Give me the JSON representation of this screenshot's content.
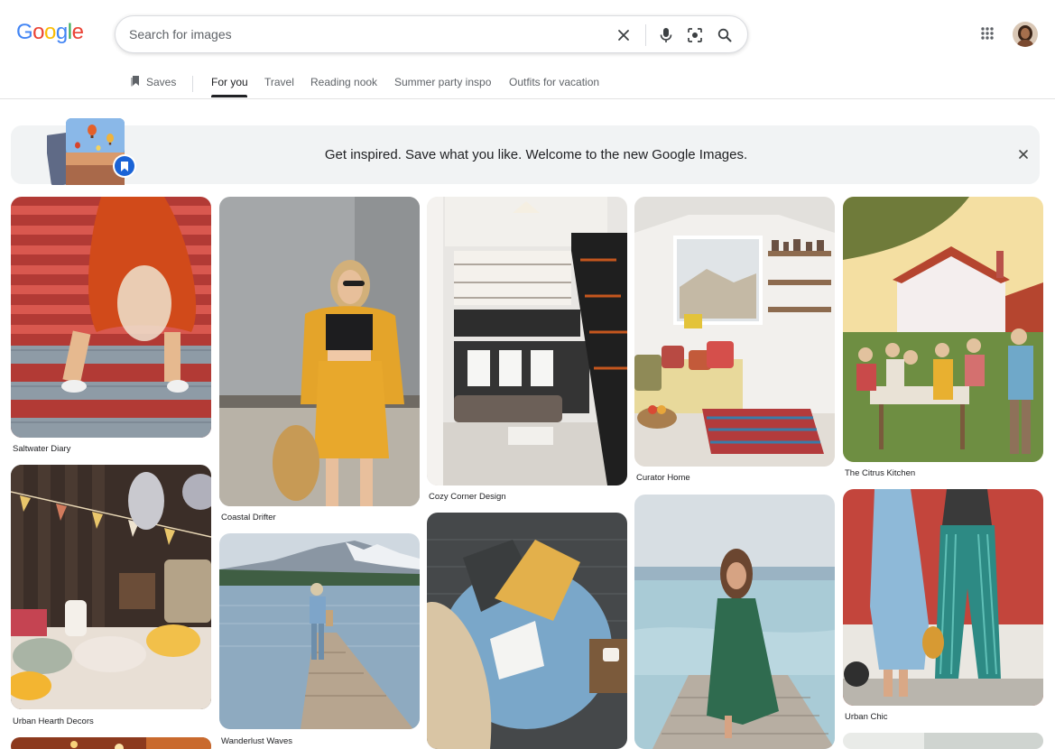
{
  "logo": {
    "letters": [
      "G",
      "o",
      "o",
      "g",
      "l",
      "e"
    ],
    "colors": [
      "#4285F4",
      "#EA4335",
      "#FBBC05",
      "#4285F4",
      "#34A853",
      "#EA4335"
    ]
  },
  "search": {
    "placeholder": "Search for images",
    "value": ""
  },
  "icons": {
    "clear": "close-icon",
    "voice": "microphone-icon",
    "lens": "camera-lens-icon",
    "search": "search-icon",
    "apps": "apps-grid-icon"
  },
  "tabs": {
    "saves": "Saves",
    "items": [
      "For you",
      "Travel",
      "Reading nook",
      "Summer party inspo",
      "Outfits for vacation"
    ],
    "active": "For you"
  },
  "banner": {
    "text": "Get inspired. Save what you like. Welcome to the new Google Images."
  },
  "cards": [
    {
      "caption": "Saltwater Diary"
    },
    {
      "caption": "Urban Hearth Decors"
    },
    {
      "caption": "Coastal Drifter"
    },
    {
      "caption": "Wanderlust Waves"
    },
    {
      "caption": "Cozy Corner Design"
    },
    {
      "caption": "Curator Home"
    },
    {
      "caption": "The Citrus Kitchen"
    },
    {
      "caption": "Urban Chic"
    }
  ]
}
